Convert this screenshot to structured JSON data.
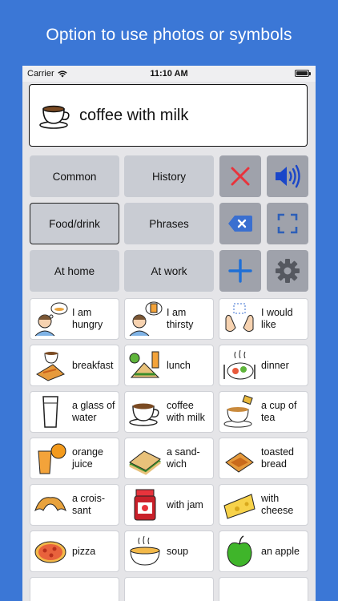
{
  "banner": {
    "text": "Option to use photos or symbols"
  },
  "status_bar": {
    "carrier": "Carrier",
    "time": "11:10 AM"
  },
  "message_bar": {
    "text": "coffee with milk",
    "icon": "coffee-cup-icon"
  },
  "categories": [
    {
      "label": "Common",
      "selected": false
    },
    {
      "label": "History",
      "selected": false
    },
    {
      "label": "Food/drink",
      "selected": true
    },
    {
      "label": "Phrases",
      "selected": false
    },
    {
      "label": "At home",
      "selected": false
    },
    {
      "label": "At work",
      "selected": false
    }
  ],
  "action_buttons": [
    {
      "icon": "clear-x-icon",
      "color": "#e8333c"
    },
    {
      "icon": "speaker-icon",
      "color": "#1a46c9"
    },
    {
      "icon": "backspace-icon",
      "color": "#3a6fd0"
    },
    {
      "icon": "fullscreen-icon",
      "color": "#2d5fb8"
    },
    {
      "icon": "plus-icon",
      "color": "#1f6fd6"
    },
    {
      "icon": "gear-icon",
      "color": "#555860"
    }
  ],
  "phrases": [
    {
      "label": "I am\nhungry",
      "icon": "hungry-person-icon"
    },
    {
      "label": "I am\nthirsty",
      "icon": "thirsty-person-icon"
    },
    {
      "label": "I would\nlike",
      "icon": "hands-want-icon"
    },
    {
      "label": "breakfast",
      "icon": "breakfast-icon"
    },
    {
      "label": "lunch",
      "icon": "lunch-icon"
    },
    {
      "label": "dinner",
      "icon": "dinner-icon"
    },
    {
      "label": "a glass of\nwater",
      "icon": "glass-of-water-icon"
    },
    {
      "label": "coffee\nwith milk",
      "icon": "coffee-cup-icon"
    },
    {
      "label": "a cup of\ntea",
      "icon": "teacup-icon"
    },
    {
      "label": "orange\njuice",
      "icon": "orange-juice-icon"
    },
    {
      "label": "a sand-\nwich",
      "icon": "sandwich-icon"
    },
    {
      "label": "toasted\nbread",
      "icon": "toast-icon"
    },
    {
      "label": "a crois-\nsant",
      "icon": "croissant-icon"
    },
    {
      "label": "with jam",
      "icon": "jam-jar-icon"
    },
    {
      "label": "with\ncheese",
      "icon": "cheese-icon"
    },
    {
      "label": "pizza",
      "icon": "pizza-icon"
    },
    {
      "label": "soup",
      "icon": "soup-bowl-icon"
    },
    {
      "label": "an apple",
      "icon": "apple-icon"
    }
  ]
}
